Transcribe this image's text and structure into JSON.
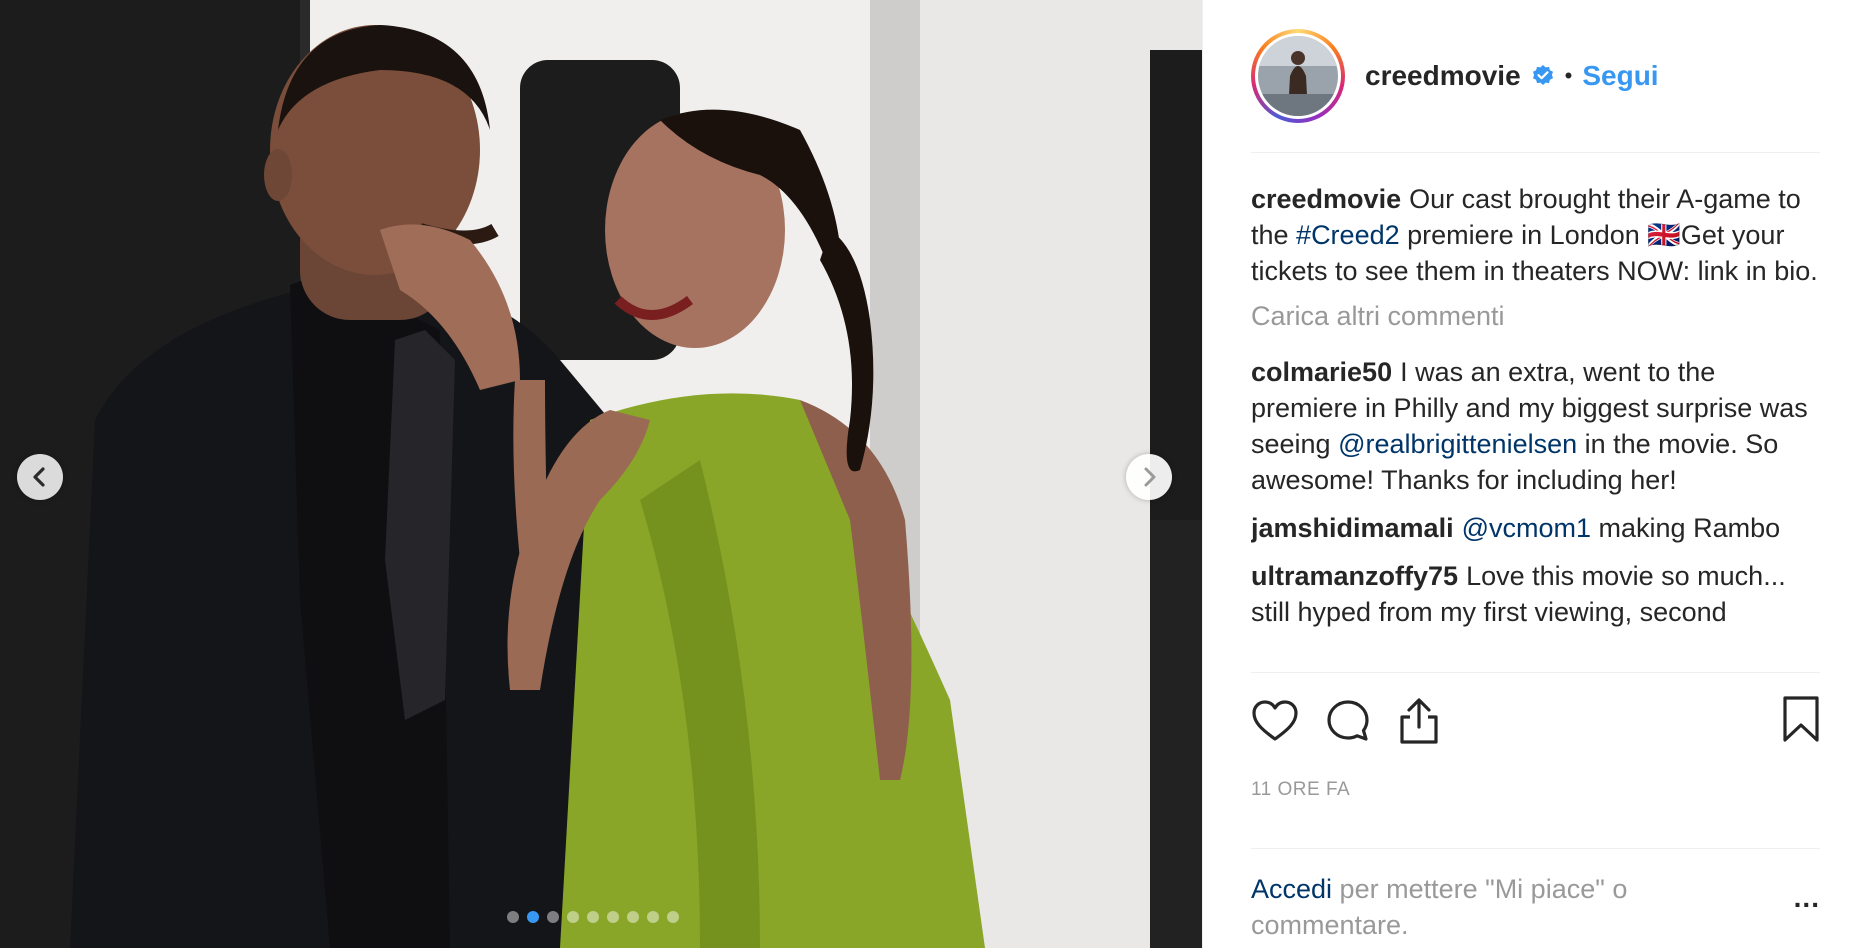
{
  "post": {
    "username": "creedmovie",
    "separator": "•",
    "follow_label": "Segui",
    "verified_icon": "verified-badge-icon",
    "accent_color": "#3897f0"
  },
  "media": {
    "slide_count": 9,
    "active_slide": 1,
    "prev_icon": "chevron-left-icon",
    "next_icon": "chevron-right-icon"
  },
  "caption": {
    "user": "creedmovie",
    "text_1": "Our cast brought their A-game to the ",
    "hashtag": "#Creed2",
    "text_2": " premiere in London 🇬🇧Get your tickets to see them in theaters NOW: link in bio."
  },
  "load_more_label": "Carica altri commenti",
  "comments": [
    {
      "user": "colmarie50",
      "text_1": "I was an extra, went to the premiere in Philly and my biggest surprise was seeing ",
      "mention": "@realbrigittenielsen",
      "text_2": " in the movie. So awesome! Thanks for including her!"
    },
    {
      "user": "jamshidimamali",
      "mention": "@vcmom1",
      "text_2": " making Rambo"
    },
    {
      "user": "ultramanzoffy75",
      "text_1": "Love this movie so much... still hyped from my first viewing, second"
    }
  ],
  "actions": {
    "like_icon": "heart-icon",
    "comment_icon": "comment-icon",
    "share_icon": "share-icon",
    "save_icon": "bookmark-icon"
  },
  "timestamp": "11 ORE FA",
  "login_prompt": {
    "link": "Accedi",
    "text": " per mettere \"Mi piace\" o commentare."
  },
  "more_options": "..."
}
